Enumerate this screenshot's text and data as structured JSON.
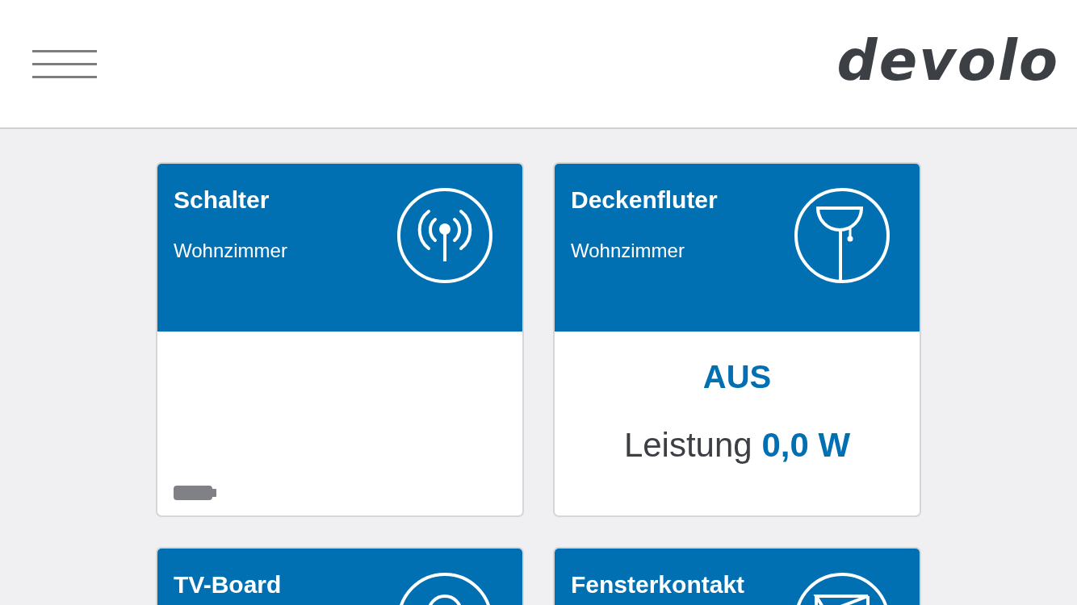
{
  "header": {
    "logo": "devolo"
  },
  "devices": [
    {
      "name": "Schalter",
      "room": "Wohnzimmer",
      "kind": "battery"
    },
    {
      "name": "Deckenfluter",
      "room": "Wohnzimmer",
      "kind": "power",
      "status": "AUS",
      "power_label": "Leistung",
      "power_value": "0,0 W"
    },
    {
      "name": "TV-Board",
      "kind": "cut"
    },
    {
      "name": "Fensterkontakt",
      "kind": "cut"
    }
  ]
}
